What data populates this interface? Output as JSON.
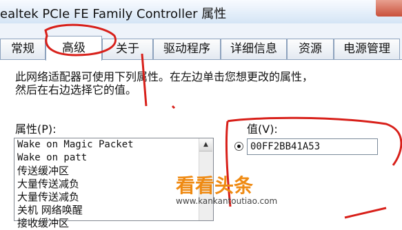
{
  "window": {
    "title": "ealtek PCIe FE Family Controller 属性"
  },
  "tabs": [
    {
      "label": "常规",
      "active": false
    },
    {
      "label": "高级",
      "active": true
    },
    {
      "label": "关于",
      "active": false
    },
    {
      "label": "驱动程序",
      "active": false
    },
    {
      "label": "详细信息",
      "active": false
    },
    {
      "label": "资源",
      "active": false
    },
    {
      "label": "电源管理",
      "active": false
    }
  ],
  "panel": {
    "description_line1": "此网络适配器可使用下列属性。在左边单击您想更改的属性，",
    "description_line2": "然后在右边选择它的值。",
    "property_label": "属性(P):",
    "value_label": "值(V):",
    "properties": [
      "Wake on Magic Packet",
      "Wake on patt",
      "传送缓冲区",
      "大量传送减负",
      "大量传送减负",
      "关机 网络唤醒",
      "接收缓冲区"
    ],
    "value": "00FF2BB41A53"
  },
  "watermark": {
    "brand": "看看头条",
    "url": "www.kankantoutiao.com"
  },
  "colors": {
    "annotation": "#d8201a",
    "watermark": "#ef8a12"
  }
}
